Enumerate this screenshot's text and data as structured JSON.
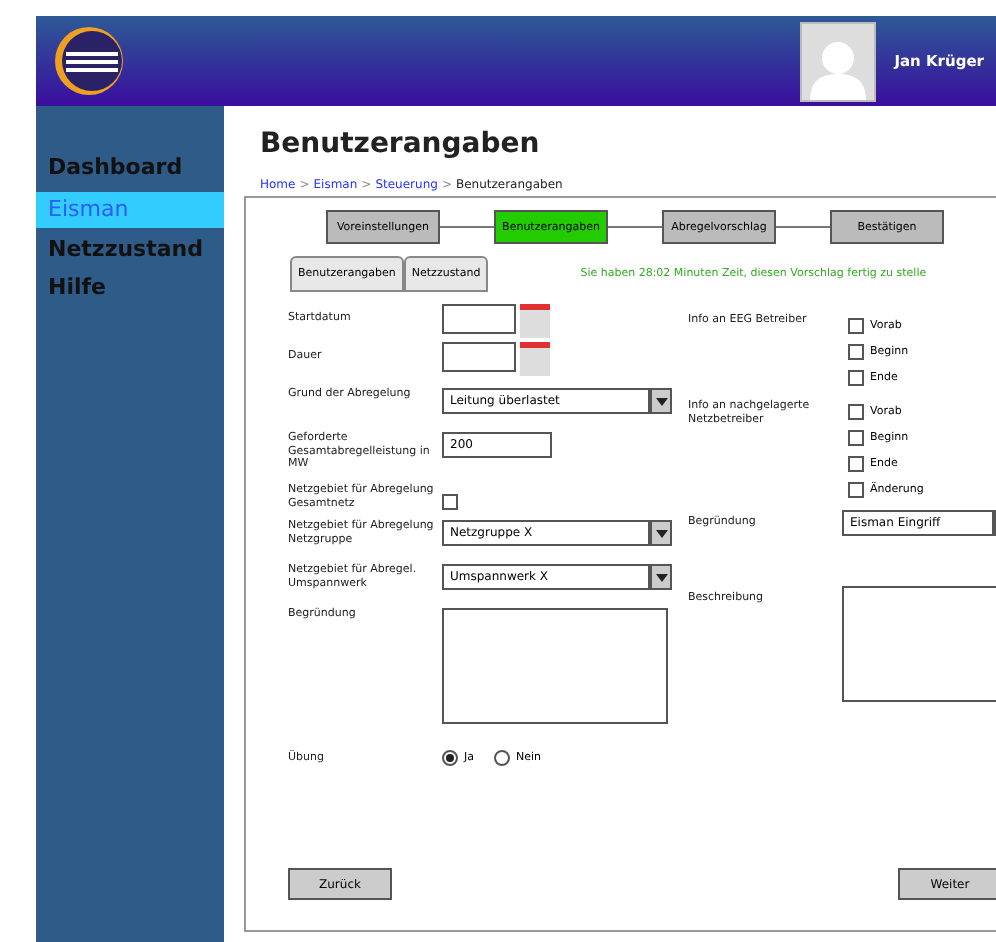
{
  "header": {
    "user_name": "Jan Krüger"
  },
  "sidebar": {
    "items": [
      {
        "label": "Dashboard",
        "selected": false
      },
      {
        "label": "Eisman",
        "selected": true
      },
      {
        "label": "Netzzustand",
        "selected": false
      },
      {
        "label": "Hilfe",
        "selected": false
      }
    ]
  },
  "title": "Benutzerangaben",
  "breadcrumb": [
    {
      "label": "Home",
      "link": true
    },
    {
      "label": "Eisman",
      "link": true
    },
    {
      "label": "Steuerung",
      "link": true
    },
    {
      "label": "Benutzerangaben",
      "link": false
    }
  ],
  "breadcrumb_separator": ">",
  "steps": [
    {
      "label": "Voreinstellungen",
      "selected": false
    },
    {
      "label": "Benutzerangaben",
      "selected": true
    },
    {
      "label": "Abregelvorschlag",
      "selected": false
    },
    {
      "label": "Bestätigen",
      "selected": false
    }
  ],
  "subtabs": [
    {
      "label": "Benutzerangaben",
      "selected": false
    },
    {
      "label": "Netzzustand",
      "selected": false
    }
  ],
  "timer_message": "Sie haben 28:02 Minuten Zeit, diesen Vorschlag fertig zu stelle",
  "left_fields": [
    {
      "kind": "date",
      "label": "Startdatum"
    },
    {
      "kind": "date",
      "label": "Dauer"
    },
    {
      "kind": "select",
      "label": "Grund der Abregelung",
      "value": "Leitung überlastet"
    },
    {
      "kind": "text",
      "label": "Geforderte Gesamtabregelleistung in MW",
      "value": "200"
    },
    {
      "kind": "checkbox",
      "label": "Netzgebiet für Abregelung Gesamtnetz",
      "checked": false
    },
    {
      "kind": "select",
      "label": "Netzgebiet für Abregelung Netzgruppe",
      "value": "Netzgruppe X"
    },
    {
      "kind": "select",
      "label": "Netzgebiet für Abregel. Umspannwerk",
      "value": "Umspannwerk X"
    },
    {
      "kind": "textarea",
      "label": "Begründung"
    }
  ],
  "right_groups": [
    {
      "label": "Info an EEG Betreiber",
      "options": [
        {
          "label": "Vorab",
          "checked": false
        },
        {
          "label": "Beginn",
          "checked": false
        },
        {
          "label": "Ende",
          "checked": false
        }
      ]
    },
    {
      "label": "Info an nachgelagerte Netzbetreiber",
      "options": [
        {
          "label": "Vorab",
          "checked": false
        },
        {
          "label": "Beginn",
          "checked": false
        },
        {
          "label": "Ende",
          "checked": false
        },
        {
          "label": "Änderung",
          "checked": false
        }
      ]
    }
  ],
  "right_fields": [
    {
      "kind": "select",
      "label": "Begründung",
      "value": "Eisman Eingriff"
    },
    {
      "kind": "textarea",
      "label": "Beschreibung"
    }
  ],
  "exercise": {
    "label": "Übung",
    "options": [
      {
        "label": "Ja",
        "selected": true
      },
      {
        "label": "Nein",
        "selected": false
      }
    ]
  },
  "buttons": {
    "back": "Zurück",
    "next": "Weiter"
  }
}
